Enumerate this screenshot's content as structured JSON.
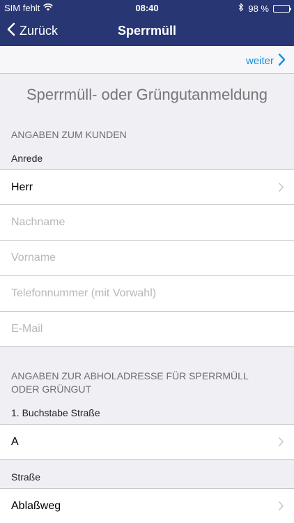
{
  "status": {
    "carrier": "SIM fehlt",
    "time": "08:40",
    "battery": "98 %",
    "battery_level": 0.98
  },
  "nav": {
    "back_label": "Zurück",
    "title": "Sperrmüll"
  },
  "toolbar": {
    "next_label": "weiter"
  },
  "page": {
    "title": "Sperrmüll- oder Grüngutanmeldung"
  },
  "customer": {
    "header": "ANGABEN ZUM KUNDEN",
    "salutation_label": "Anrede",
    "salutation_value": "Herr",
    "lastname_placeholder": "Nachname",
    "firstname_placeholder": "Vorname",
    "phone_placeholder": "Telefonnummer (mit Vorwahl)",
    "email_placeholder": "E-Mail"
  },
  "pickup": {
    "header_line1": "ANGABEN ZUR ABHOLADRESSE FÜR SPERRMÜLL",
    "header_line2": "ODER GRÜNGUT",
    "letter_label": "1. Buchstabe Straße",
    "letter_value": "A",
    "street_label": "Straße",
    "street_value": "Ablaßweg"
  },
  "colors": {
    "nav_bg": "#283673",
    "accent": "#1b8fd8",
    "background": "#efeff4"
  }
}
